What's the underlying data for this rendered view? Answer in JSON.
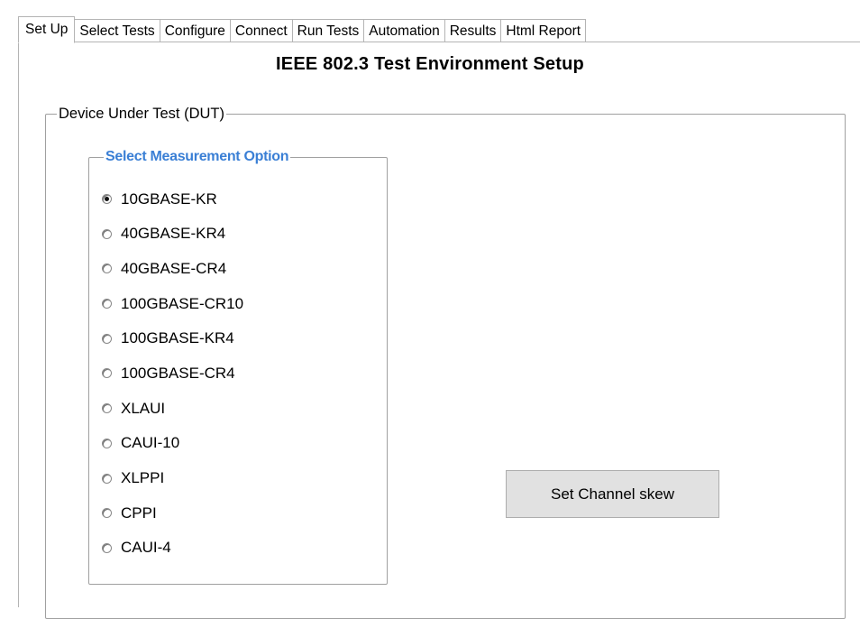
{
  "tabs": [
    {
      "label": "Set Up",
      "active": true
    },
    {
      "label": "Select Tests"
    },
    {
      "label": "Configure"
    },
    {
      "label": "Connect"
    },
    {
      "label": "Run Tests"
    },
    {
      "label": "Automation"
    },
    {
      "label": "Results"
    },
    {
      "label": "Html Report"
    }
  ],
  "page": {
    "title": "IEEE 802.3 Test Environment Setup"
  },
  "dut_group": {
    "legend": "Device Under Test (DUT)"
  },
  "measurement": {
    "legend": "Select Measurement Option",
    "selected": "10GBASE-KR",
    "options": [
      "10GBASE-KR",
      "40GBASE-KR4",
      "40GBASE-CR4",
      "100GBASE-CR10",
      "100GBASE-KR4",
      "100GBASE-CR4",
      "XLAUI",
      "CAUI-10",
      "XLPPI",
      "CPPI",
      "CAUI-4"
    ]
  },
  "buttons": {
    "set_channel_skew": "Set Channel skew"
  },
  "colors": {
    "legend_accent": "#3a7fd5",
    "button_face": "#e1e1e1",
    "border": "#b4b4b4"
  }
}
